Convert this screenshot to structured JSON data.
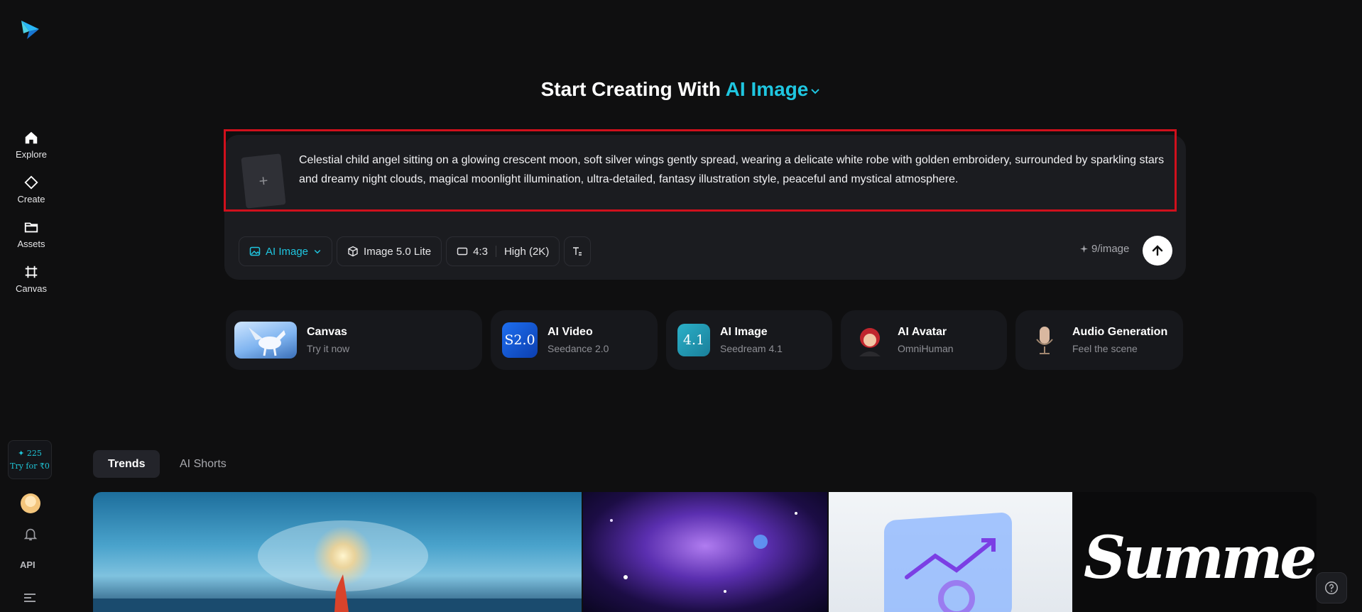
{
  "sidebar": {
    "logo_icon": "paper-plane-logo",
    "items": [
      {
        "label": "Explore",
        "icon": "home-icon"
      },
      {
        "label": "Create",
        "icon": "diamond-icon"
      },
      {
        "label": "Assets",
        "icon": "folder-icon"
      },
      {
        "label": "Canvas",
        "icon": "frame-icon"
      }
    ],
    "credits": {
      "amount": "✦ 225",
      "offer": "Try for ₹0"
    },
    "api_label": "API"
  },
  "headline": {
    "prefix": "Start Creating With",
    "mode": "AI Image"
  },
  "prompt": {
    "text": "Celestial child angel sitting on a glowing crescent moon, soft silver wings gently spread, wearing a delicate white robe with golden embroidery, surrounded by sparkling stars and dreamy night clouds, magical moonlight illumination, ultra-detailed, fantasy illustration style, peaceful and mystical atmosphere.",
    "add_reference": "+"
  },
  "toolbar": {
    "mode_label": "AI Image",
    "model_label": "Image 5.0 Lite",
    "ratio_label": "4:3",
    "quality_label": "High (2K)",
    "cost_label": "9/image"
  },
  "features": [
    {
      "title": "Canvas",
      "subtitle": "Try it now"
    },
    {
      "title": "AI Video",
      "subtitle": "Seedance 2.0",
      "badge": "S2.0"
    },
    {
      "title": "AI Image",
      "subtitle": "Seedream 4.1",
      "badge": "4.1"
    },
    {
      "title": "AI Avatar",
      "subtitle": "OmniHuman"
    },
    {
      "title": "Audio Generation",
      "subtitle": "Feel the scene"
    }
  ],
  "tabs": [
    {
      "label": "Trends",
      "active": true
    },
    {
      "label": "AI Shorts",
      "active": false
    }
  ],
  "gallery": {
    "tile4_text": "Summer"
  },
  "colors": {
    "accent": "#1fc6e0",
    "background": "#0f0f10",
    "card": "#1b1c20",
    "highlight_border": "#d0101c"
  }
}
